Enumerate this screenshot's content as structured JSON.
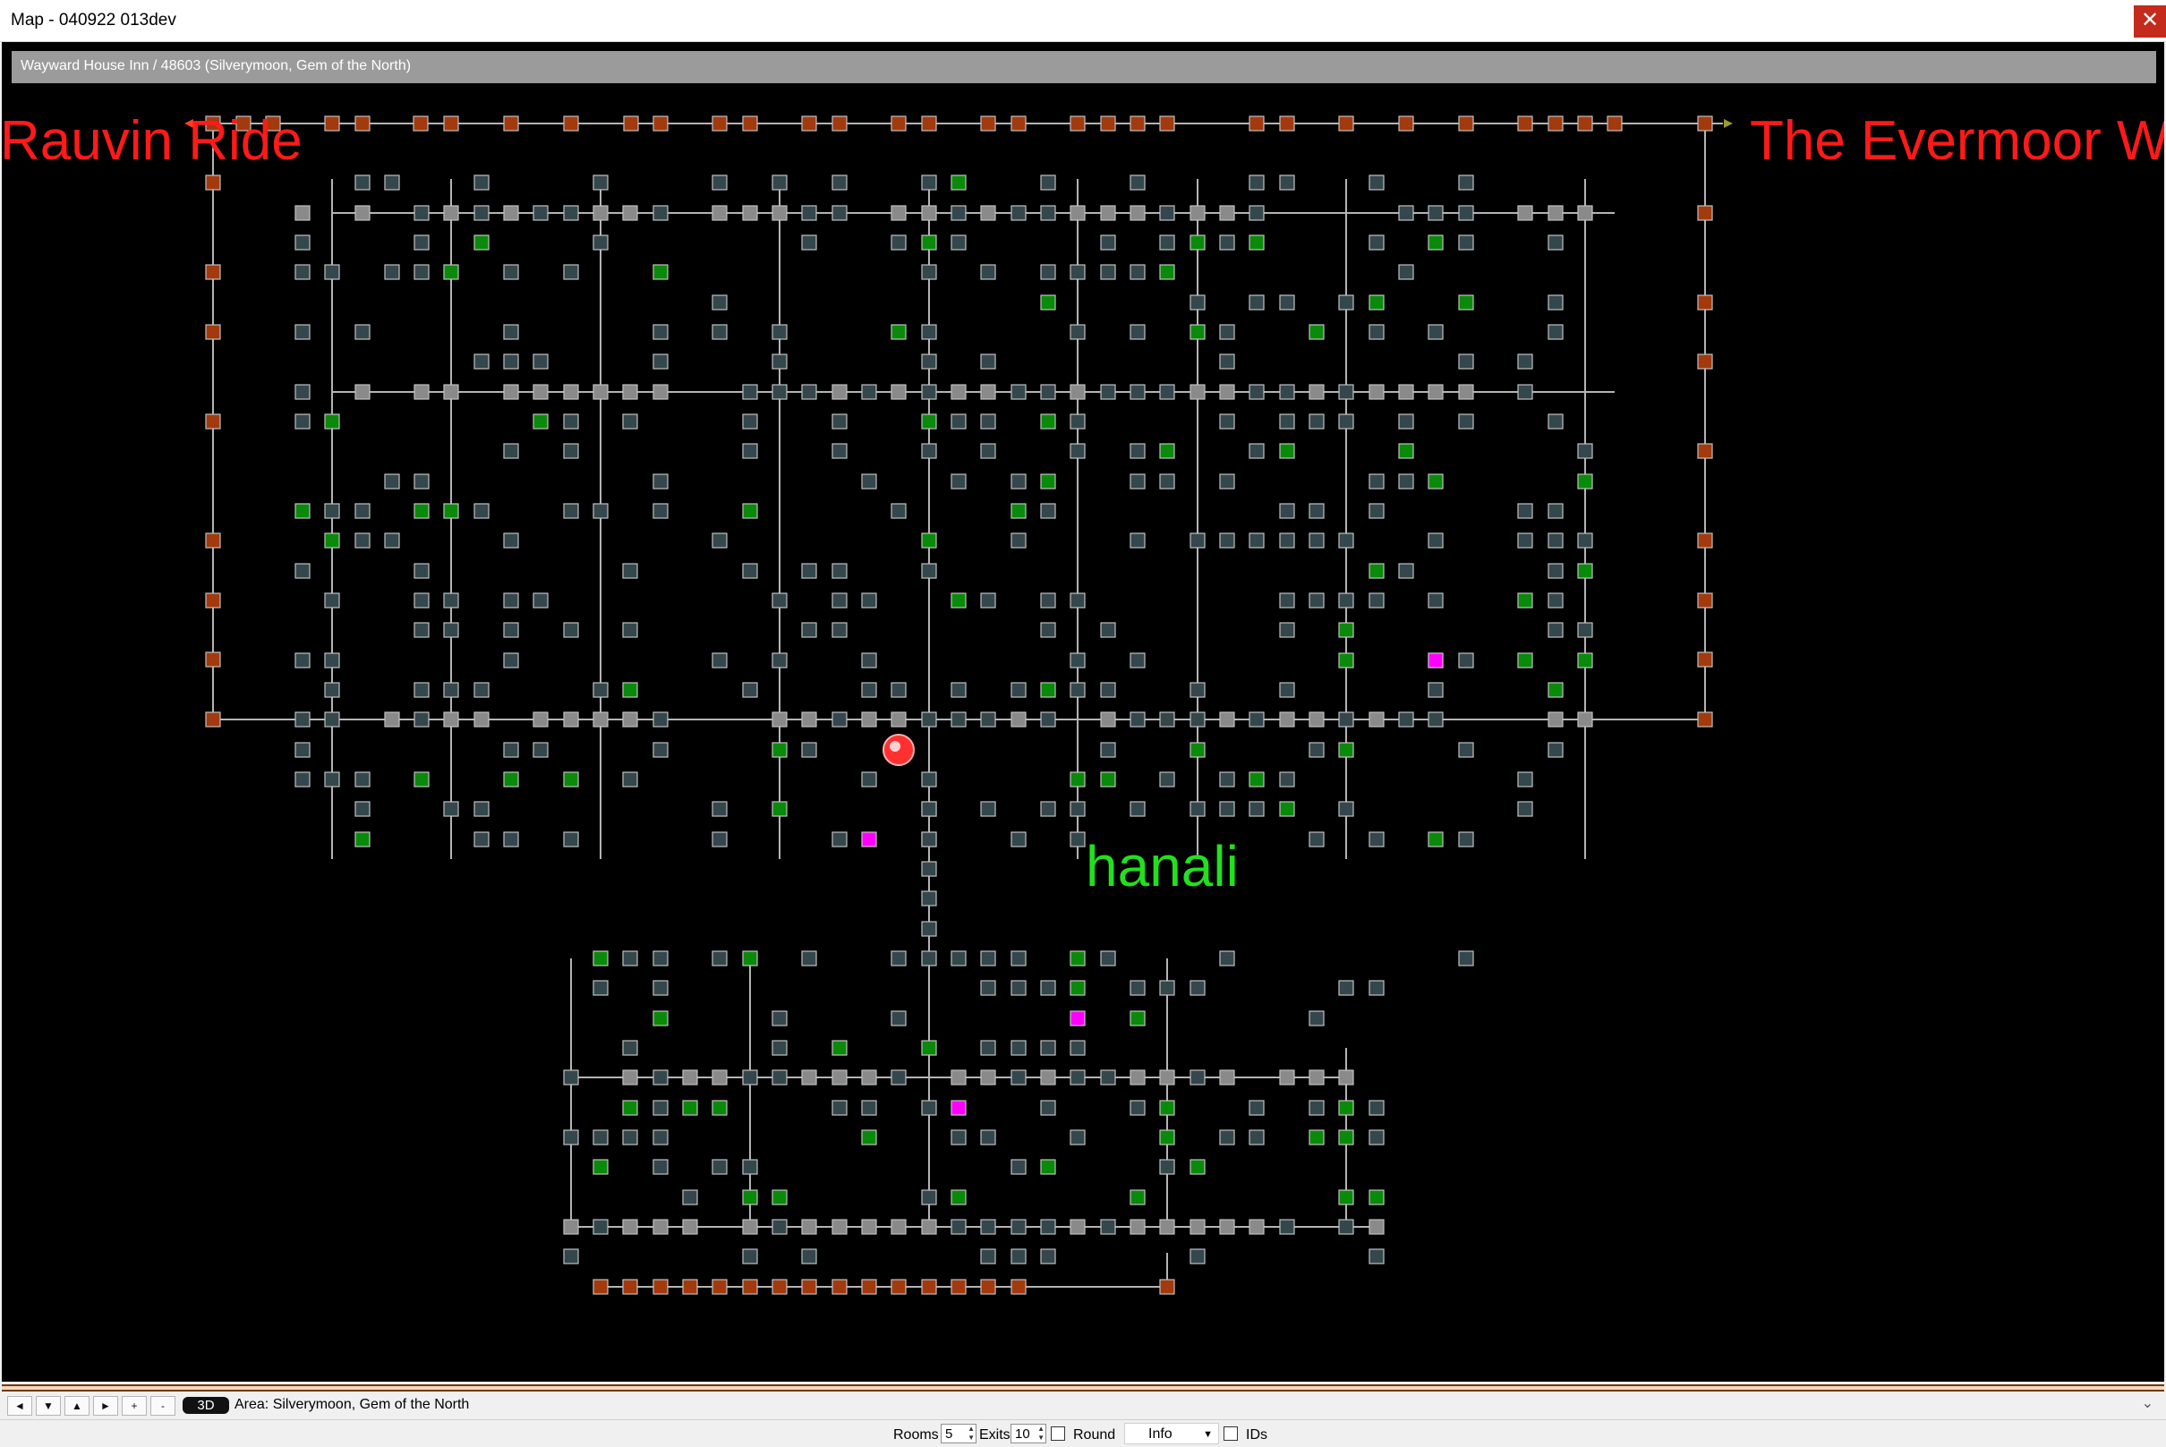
{
  "window": {
    "title": "Map - 040922 013dev",
    "close_icon": "close-icon"
  },
  "map": {
    "info_bar": "Wayward House Inn / 48603 (Silverymoon, Gem of the North)",
    "area_labels": {
      "left": "Rauvin Ride",
      "right": "The Evermoor W",
      "player": "hanali"
    },
    "colors": {
      "background": "#000000",
      "room": "#34474d",
      "room_gray": "#8a8a8a",
      "room_green": "#0a8a0a",
      "room_orange": "#a23a0e",
      "room_magenta": "#ff00ff",
      "exit_line": "#b4b4b4",
      "area_label": "#ff1a1a",
      "player_label": "#22e01e",
      "player_marker": "#ff3030",
      "up_down_marker": "#c8c800"
    }
  },
  "navigation": {
    "buttons": [
      {
        "icon": "arrow-left-icon",
        "label": "◄"
      },
      {
        "icon": "arrow-down-icon",
        "label": "▼"
      },
      {
        "icon": "arrow-up-icon",
        "label": "▲"
      },
      {
        "icon": "arrow-right-icon",
        "label": "►"
      },
      {
        "icon": "plus-icon",
        "label": "+"
      },
      {
        "icon": "minus-icon",
        "label": "-"
      }
    ],
    "view_3d_label": "3D",
    "area_text": "Area: Silverymoon, Gem of the North"
  },
  "controls": {
    "rooms_label": "Rooms",
    "rooms_value": "5",
    "exits_label": "Exits",
    "exits_value": "10",
    "round_label": "Round",
    "info_value": "Info",
    "ids_label": "IDs"
  }
}
